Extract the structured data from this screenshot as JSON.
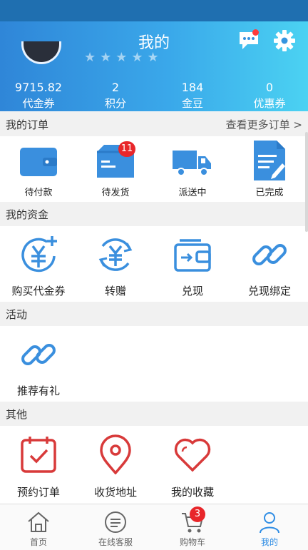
{
  "header": {
    "title": "我的"
  },
  "stats": [
    {
      "value": "9715.82",
      "label": "代金券"
    },
    {
      "value": "2",
      "label": "积分"
    },
    {
      "value": "184",
      "label": "金豆"
    },
    {
      "value": "0",
      "label": "优惠券"
    }
  ],
  "orders": {
    "title": "我的订单",
    "more": "查看更多订单 >",
    "items": [
      {
        "label": "待付款",
        "icon": "wallet-icon"
      },
      {
        "label": "待发货",
        "icon": "box-icon",
        "badge": "11"
      },
      {
        "label": "派送中",
        "icon": "truck-icon"
      },
      {
        "label": "已完成",
        "icon": "document-done-icon"
      }
    ]
  },
  "funds": {
    "title": "我的资金",
    "items": [
      {
        "label": "购买代金券",
        "icon": "yuan-plus-icon"
      },
      {
        "label": "转赠",
        "icon": "yuan-transfer-icon"
      },
      {
        "label": "兑现",
        "icon": "wallet-cash-icon"
      },
      {
        "label": "兑现绑定",
        "icon": "link-icon"
      }
    ]
  },
  "activity": {
    "title": "活动",
    "items": [
      {
        "label": "推荐有礼",
        "icon": "link-icon"
      }
    ]
  },
  "other": {
    "title": "其他",
    "items": [
      {
        "label": "预约订单",
        "icon": "calendar-check-icon"
      },
      {
        "label": "收货地址",
        "icon": "location-pin-icon"
      },
      {
        "label": "我的收藏",
        "icon": "heart-icon"
      }
    ]
  },
  "tabbar": {
    "items": [
      {
        "label": "首页",
        "icon": "home-icon"
      },
      {
        "label": "在线客服",
        "icon": "chat-icon"
      },
      {
        "label": "购物车",
        "icon": "cart-icon",
        "badge": "3"
      },
      {
        "label": "我的",
        "icon": "user-icon",
        "active": true
      }
    ]
  },
  "colors": {
    "accent": "#2f8de4",
    "red_icons": "#d83a3a",
    "badge": "#e8262a"
  }
}
